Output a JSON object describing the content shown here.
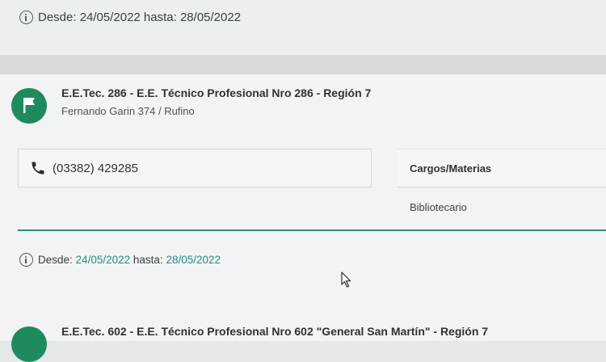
{
  "top_notice": {
    "label": "Desde: 24/05/2022 hasta: 28/05/2022"
  },
  "school": {
    "name": "E.E.Tec. 286 - E.E. Técnico Profesional Nro 286 - Región 7",
    "address": "Fernando Garin 374 / Rufino",
    "phone": "(03382) 429285",
    "cargos_header": "Cargos/Materias",
    "cargos": [
      "Bibliotecario"
    ],
    "dates": {
      "desde_label": "Desde:",
      "desde": "24/05/2022",
      "hasta_label": "hasta:",
      "hasta": "28/05/2022"
    }
  },
  "next_school": {
    "name": "E.E.Tec. 602 - E.E. Técnico Profesional Nro 602 \"General San Martín\" - Región 7"
  },
  "colors": {
    "accent_green": "#1e8a5e",
    "teal_line": "#2a8f74",
    "date_teal": "#2a8a86"
  },
  "icons": [
    "info-icon",
    "flag-icon",
    "phone-icon",
    "mouse-cursor-icon"
  ]
}
